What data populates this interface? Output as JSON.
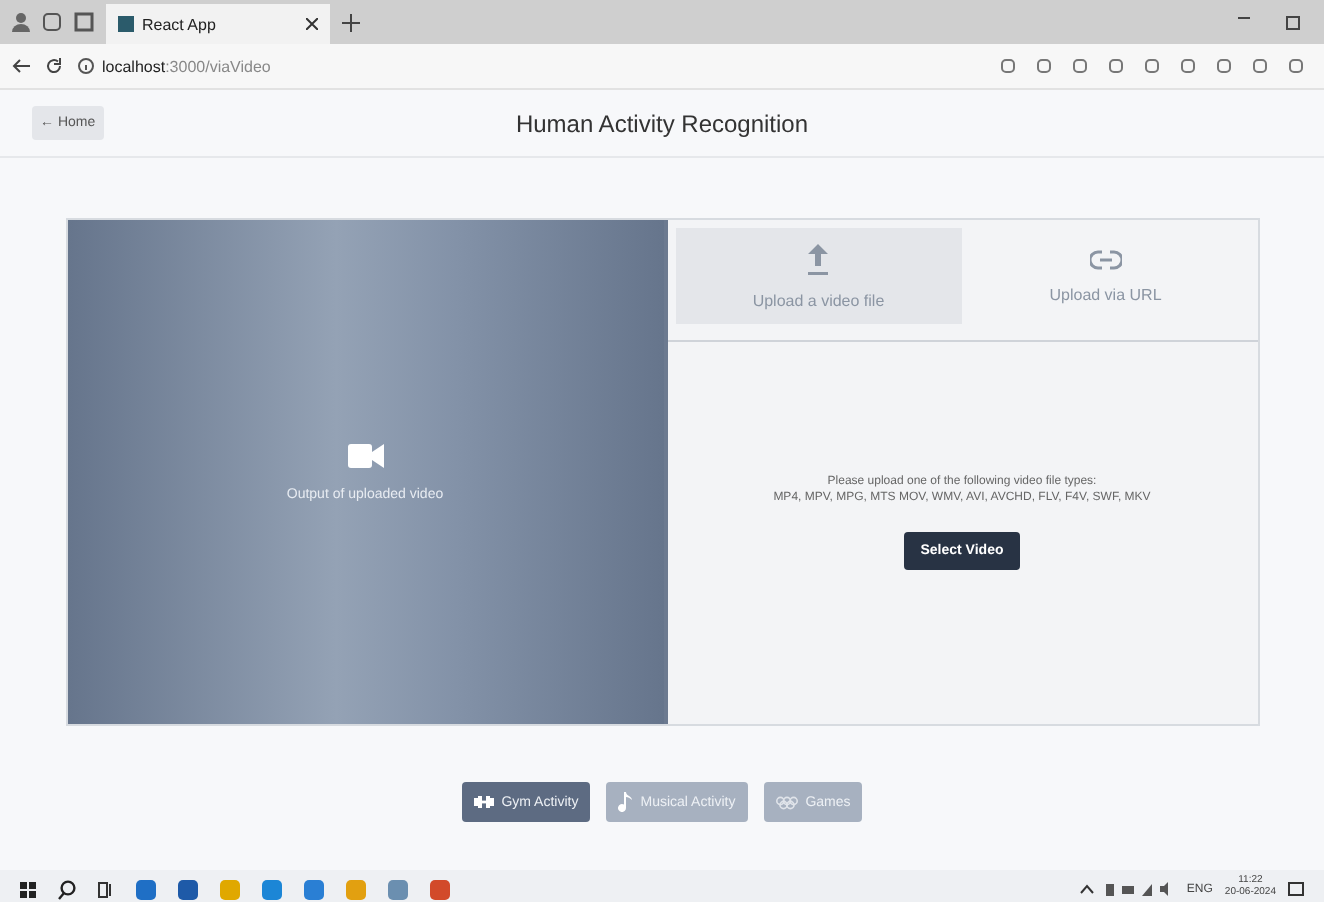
{
  "browser": {
    "tab_title": "React App",
    "url_host": "localhost",
    "url_path": ":3000/viaVideo"
  },
  "header": {
    "back_button": "← Home",
    "title": "Human Activity Recognition"
  },
  "video_panel": {
    "caption": "Output of uploaded video"
  },
  "upload_tabs": [
    {
      "label": "Upload a video file",
      "kind": "file",
      "selected": true
    },
    {
      "label": "Upload via URL",
      "kind": "link",
      "selected": false
    }
  ],
  "upload": {
    "instructions": "Please upload one of the following video file types:",
    "formats": "MP4, MPV, MPG, MTS MOV, WMV, AVI, AVCHD, FLV, F4V, SWF, MKV",
    "button": "Select Video"
  },
  "categories": [
    {
      "label": "Gym Activity",
      "kind": "gym",
      "selected": true
    },
    {
      "label": "Musical Activity",
      "kind": "music",
      "selected": false
    },
    {
      "label": "Games",
      "kind": "games",
      "selected": false
    }
  ],
  "taskbar": {
    "language": "ENG",
    "time": "11:22",
    "date": "20-06-2024"
  }
}
